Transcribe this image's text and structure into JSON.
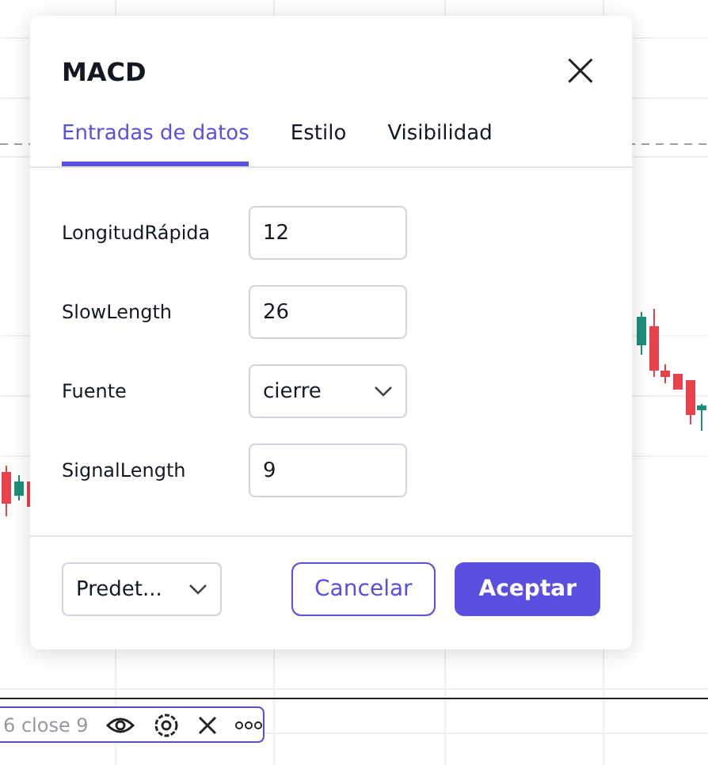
{
  "dialog": {
    "title": "MACD",
    "close": "×",
    "tabs": [
      {
        "label": "Entradas de datos",
        "selected": true
      },
      {
        "label": "Estilo",
        "selected": false
      },
      {
        "label": "Visibilidad",
        "selected": false
      }
    ],
    "fields": [
      {
        "label": "LongitudRápida",
        "kind": "input",
        "value": "12"
      },
      {
        "label": "SlowLength",
        "kind": "input",
        "value": "26"
      },
      {
        "label": "Fuente",
        "kind": "select",
        "value": "cierre"
      },
      {
        "label": "SignalLength",
        "kind": "input",
        "value": "9"
      }
    ],
    "preset": "Predet...",
    "buttons": [
      {
        "label": "Cancelar",
        "kind": "secondary"
      },
      {
        "label": "Aceptar",
        "kind": "primary"
      }
    ]
  },
  "legend": {
    "text": "6 close 9"
  }
}
